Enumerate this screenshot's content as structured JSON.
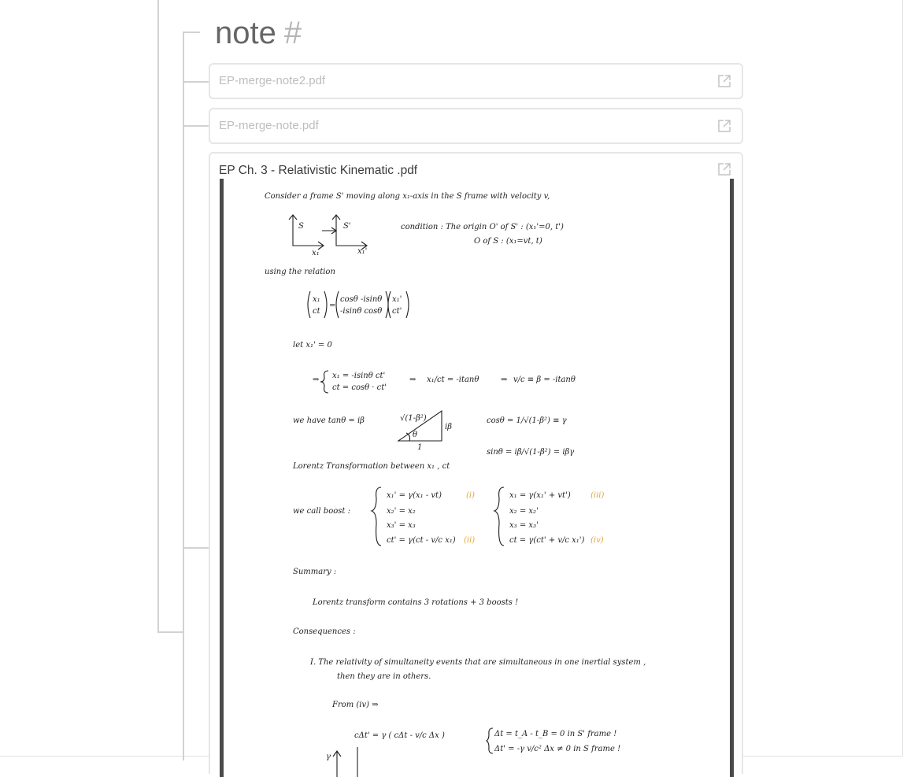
{
  "note": {
    "title": "note",
    "hash": "#"
  },
  "files": [
    {
      "name": "EP-merge-note2.pdf",
      "state": "collapsed",
      "open_icon": "external-link-icon"
    },
    {
      "name": "EP-merge-note.pdf",
      "state": "collapsed",
      "open_icon": "external-link-icon"
    },
    {
      "name": "EP Ch. 3 - Relativistic Kinematic .pdf",
      "state": "expanded",
      "open_icon": "external-link-icon"
    }
  ],
  "pdf_content": {
    "intro": "Consider a frame S' moving along x₁-axis in the S frame with velocity v,",
    "frame_s": "S",
    "frame_s_prime": "S'",
    "axis_x1": "x₁",
    "axis_x1_prime": "x₁'",
    "condition_1": "condition : The origin O' of S' : (x₁'=0, t')",
    "condition_2": "O of S : (x₁=vt, t)",
    "using_relation": "using the relation",
    "matrix_lhs_1": "x₁",
    "matrix_lhs_2": "ct",
    "matrix_eq": "=",
    "matrix_r1": "cosθ   -isinθ",
    "matrix_r2": "-isinθ   cosθ",
    "matrix_v1": "x₁'",
    "matrix_v2": "ct'",
    "let": "let   x₁' = 0",
    "sys_1": "x₁ = -isinθ ct'",
    "sys_2": "ct = cosθ · ct'",
    "implies": "⇒",
    "ratio_1": "x₁/ct = -itanθ",
    "ratio_2": "v/c ≡ β = -itanθ",
    "we_have": "we have   tanθ = iβ",
    "tri_hyp": "√(1-β²)",
    "tri_opp": "iβ",
    "tri_adj": "1",
    "tri_angle": "θ",
    "cos_eq": "cosθ = 1/√(1-β²) ≡ γ",
    "sin_eq": "sinθ = iβ/√(1-β²) = iβγ",
    "lorentz_heading": "Lorentz Transformation between x₁ , ct",
    "we_call_boost": "we call boost :",
    "boost_l1": "x₁' = γ(x₁ - vt)",
    "boost_l2": "x₂' = x₂",
    "boost_l3": "x₃' = x₃",
    "boost_l4": "ct' = γ(ct - v/c x₁)",
    "boost_r1": "x₁ = γ(x₁' + vt')",
    "boost_r2": "x₂ = x₂'",
    "boost_r3": "x₃ = x₃'",
    "boost_r4": "ct = γ(ct' + v/c x₁')",
    "tag_i": "(i)",
    "tag_ii": "(ii)",
    "tag_iii": "(iii)",
    "tag_iv": "(iv)",
    "summary_heading": "Summary :",
    "summary_text": "Lorentz transform contains 3 rotations + 3 boosts !",
    "consequences_heading": "Consequences :",
    "item_1a": "I.  The relativity of simultaneity events that are simultaneous in one inertial system ,",
    "item_1b": "then they are    in others.",
    "from_iv": "From (iv) ⇒",
    "delta_eq": "cΔt' = γ ( cΔt - v/c Δx )",
    "delta_c1": "Δt = t_A - t_B = 0    in S' frame !",
    "delta_c2": "Δt' = -γ v/c² Δx ≠ 0  in S frame !",
    "gamma_axis": "γ"
  }
}
